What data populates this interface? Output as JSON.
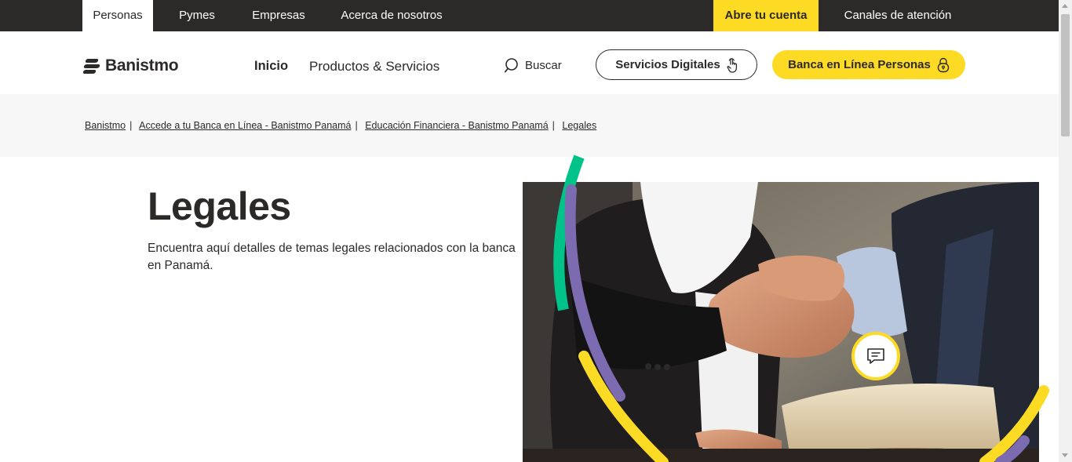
{
  "topbar": {
    "tabs": [
      {
        "label": "Personas"
      },
      {
        "label": "Pymes"
      },
      {
        "label": "Empresas"
      },
      {
        "label": "Acerca de nosotros"
      }
    ],
    "cta_label": "Abre tu cuenta",
    "support_label": "Canales de atención"
  },
  "header": {
    "logo_text": "Banistmo",
    "nav": [
      {
        "label": "Inicio"
      },
      {
        "label": "Productos & Servicios"
      }
    ],
    "search_label": "Buscar",
    "digital_button": "Servicios Digitales",
    "online_button": "Banca en Línea Personas"
  },
  "breadcrumb": [
    {
      "label": "Banistmo"
    },
    {
      "label": "Accede a tu Banca en Línea - Banistmo Panamá"
    },
    {
      "label": "Educación Financiera - Banistmo Panamá"
    },
    {
      "label": "Legales"
    }
  ],
  "hero": {
    "title": "Legales",
    "description": "Encuentra aquí detalles de temas legales relacionados con la banca en Panamá."
  },
  "colors": {
    "dark": "#2c2a29",
    "yellow": "#fdda24",
    "green": "#00c389",
    "purple": "#7c6bb0"
  },
  "icons": {
    "search": "search-icon",
    "touch": "touch-icon",
    "lock": "lock-icon",
    "chat": "chat-icon"
  }
}
